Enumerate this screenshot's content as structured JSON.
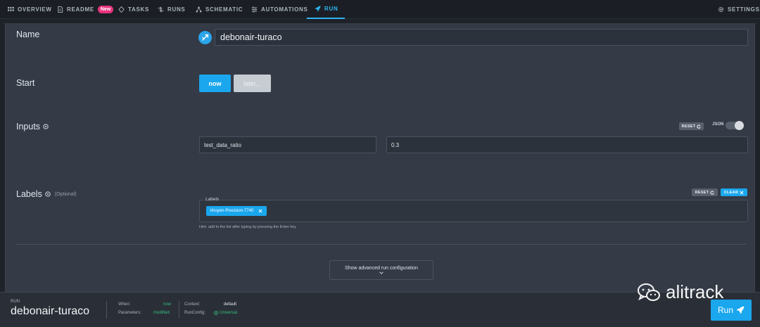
{
  "nav": {
    "items": [
      {
        "label": "OVERVIEW",
        "icon": "grid-icon"
      },
      {
        "label": "README",
        "icon": "document-icon",
        "badge": "New"
      },
      {
        "label": "TASKS",
        "icon": "tasks-icon"
      },
      {
        "label": "RUNS",
        "icon": "runs-icon"
      },
      {
        "label": "SCHEMATIC",
        "icon": "schematic-icon"
      },
      {
        "label": "AUTOMATIONS",
        "icon": "automations-icon"
      },
      {
        "label": "RUN",
        "icon": "rocket-icon",
        "active": true
      }
    ],
    "settings": "SETTINGS"
  },
  "form": {
    "name_label": "Name",
    "name_value": "debonair-turaco",
    "start_label": "Start",
    "start_now": "now",
    "start_later": "later...",
    "inputs_label": "Inputs",
    "reset": "RESET",
    "json": "JSON",
    "input_key": "test_data_ratio",
    "input_value": "0.3",
    "labels_label": "Labels",
    "labels_optional": "(Optional)",
    "clear": "CLEAR",
    "labels_legend": "Labels",
    "chip": "khuyen-Precision-7740",
    "hint": "Hint: add to the list after typing by pressing the Enter key",
    "advanced": "Show advanced run configuration"
  },
  "footer": {
    "caption": "RUN",
    "run_name": "debonair-turaco",
    "when_label": "When:",
    "when_value": "now",
    "params_label": "Parameters:",
    "params_value": "modified",
    "context_label": "Context:",
    "context_value": "default",
    "runconfig_label": "RunConfig:",
    "runconfig_value": "Universal",
    "run_button": "Run"
  },
  "watermark": "alitrack",
  "colors": {
    "accent": "#1aa7ee",
    "badge": "#e8337f",
    "status_green": "#35c07f"
  }
}
